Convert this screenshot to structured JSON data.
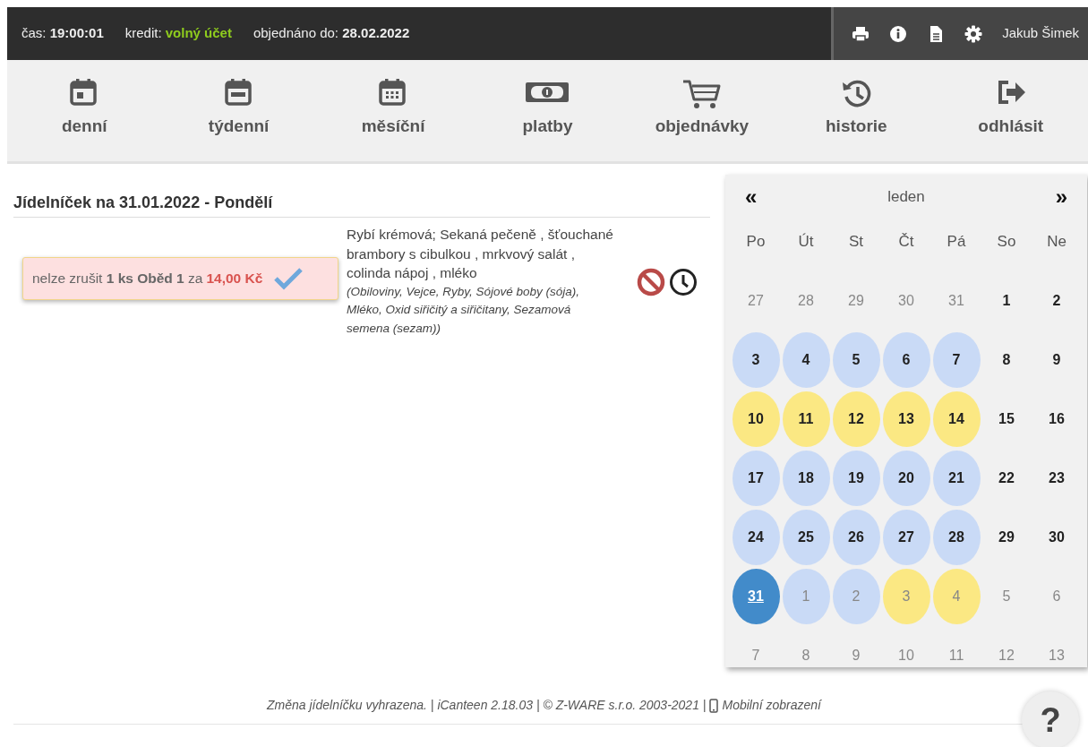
{
  "top_bar": {
    "info": [
      {
        "label": "čas:",
        "value": "19:00:01",
        "kind": "plain"
      },
      {
        "label": "kredit:",
        "value": "volný účet",
        "kind": "status"
      },
      {
        "label": "objednáno do:",
        "value": "28.02.2022",
        "kind": "plain"
      }
    ],
    "tools": [
      {
        "kind": "print"
      },
      {
        "kind": "info"
      },
      {
        "kind": "document"
      },
      {
        "kind": "settings"
      }
    ],
    "user": "Jakub Šimek"
  },
  "nav": [
    {
      "label": "denní",
      "kind": "day"
    },
    {
      "label": "týdenní",
      "kind": "week"
    },
    {
      "label": "měsíční",
      "kind": "month"
    },
    {
      "label": "platby",
      "kind": "money"
    },
    {
      "label": "objednávky",
      "kind": "cart"
    },
    {
      "label": "historie",
      "kind": "history"
    },
    {
      "label": "odhlásit",
      "kind": "logout"
    }
  ],
  "menu": {
    "title": "Jídelníček na 31.01.2022 - Pondělí",
    "order": {
      "text": "nelze zrušit **1 ks Oběd 1** za",
      "price": "14,00 Kč",
      "checked": true
    },
    "dish": "Rybí krémová; Sekaná pečeně , šťouchané brambory s cibulkou , mrkvový salát , colinda nápoj , mléko",
    "allergens": "(Obiloviny, Vejce, Ryby, Sójové boby (sója), Mléko, Oxid siřičitý a siřičitany, Sezamová semena (sezam))"
  },
  "calendar": {
    "prev": "«",
    "month": "leden",
    "next": "»",
    "weekdays": [
      "Po",
      "Út",
      "St",
      "Čt",
      "Pá",
      "So",
      "Ne"
    ],
    "days": [
      {
        "day": "27",
        "muted": true,
        "selected": false
      },
      {
        "day": "28",
        "muted": true,
        "selected": false
      },
      {
        "day": "29",
        "muted": true,
        "selected": false
      },
      {
        "day": "30",
        "muted": true,
        "selected": false
      },
      {
        "day": "31",
        "muted": true,
        "selected": false
      },
      {
        "day": "1",
        "muted": false,
        "selected": false
      },
      {
        "day": "2",
        "muted": false,
        "selected": false
      },
      {
        "day": "3",
        "muted": false,
        "selected": false,
        "color": "#c9daf6"
      },
      {
        "day": "4",
        "muted": false,
        "selected": false,
        "color": "#c9daf6"
      },
      {
        "day": "5",
        "muted": false,
        "selected": false,
        "color": "#c9daf6"
      },
      {
        "day": "6",
        "muted": false,
        "selected": false,
        "color": "#c9daf6"
      },
      {
        "day": "7",
        "muted": false,
        "selected": false,
        "color": "#c9daf6"
      },
      {
        "day": "8",
        "muted": false,
        "selected": false
      },
      {
        "day": "9",
        "muted": false,
        "selected": false
      },
      {
        "day": "10",
        "muted": false,
        "selected": false,
        "color": "#fbe883"
      },
      {
        "day": "11",
        "muted": false,
        "selected": false,
        "color": "#fbe883"
      },
      {
        "day": "12",
        "muted": false,
        "selected": false,
        "color": "#fbe883"
      },
      {
        "day": "13",
        "muted": false,
        "selected": false,
        "color": "#fbe883"
      },
      {
        "day": "14",
        "muted": false,
        "selected": false,
        "color": "#fbe883"
      },
      {
        "day": "15",
        "muted": false,
        "selected": false
      },
      {
        "day": "16",
        "muted": false,
        "selected": false
      },
      {
        "day": "17",
        "muted": false,
        "selected": false,
        "color": "#c9daf6"
      },
      {
        "day": "18",
        "muted": false,
        "selected": false,
        "color": "#c9daf6"
      },
      {
        "day": "19",
        "muted": false,
        "selected": false,
        "color": "#c9daf6"
      },
      {
        "day": "20",
        "muted": false,
        "selected": false,
        "color": "#c9daf6"
      },
      {
        "day": "21",
        "muted": false,
        "selected": false,
        "color": "#c9daf6"
      },
      {
        "day": "22",
        "muted": false,
        "selected": false
      },
      {
        "day": "23",
        "muted": false,
        "selected": false
      },
      {
        "day": "24",
        "muted": false,
        "selected": false,
        "color": "#c9daf6"
      },
      {
        "day": "25",
        "muted": false,
        "selected": false,
        "color": "#c9daf6"
      },
      {
        "day": "26",
        "muted": false,
        "selected": false,
        "color": "#c9daf6"
      },
      {
        "day": "27",
        "muted": false,
        "selected": false,
        "color": "#c9daf6"
      },
      {
        "day": "28",
        "muted": false,
        "selected": false,
        "color": "#c9daf6"
      },
      {
        "day": "29",
        "muted": false,
        "selected": false
      },
      {
        "day": "30",
        "muted": false,
        "selected": false
      },
      {
        "day": "31",
        "muted": false,
        "selected": true,
        "color": "#428bca"
      },
      {
        "day": "1",
        "muted": true,
        "selected": false,
        "color": "#c9daf6"
      },
      {
        "day": "2",
        "muted": true,
        "selected": false,
        "color": "#c9daf6"
      },
      {
        "day": "3",
        "muted": true,
        "selected": false,
        "color": "#fbe883"
      },
      {
        "day": "4",
        "muted": true,
        "selected": false,
        "color": "#fbe883"
      },
      {
        "day": "5",
        "muted": true,
        "selected": false
      },
      {
        "day": "6",
        "muted": true,
        "selected": false
      },
      {
        "day": "7",
        "muted": true,
        "selected": false
      },
      {
        "day": "8",
        "muted": true,
        "selected": false
      },
      {
        "day": "9",
        "muted": true,
        "selected": false
      },
      {
        "day": "10",
        "muted": true,
        "selected": false
      },
      {
        "day": "11",
        "muted": true,
        "selected": false
      },
      {
        "day": "12",
        "muted": true,
        "selected": false
      },
      {
        "day": "13",
        "muted": true,
        "selected": false
      }
    ]
  },
  "footer": {
    "text": "Změna jídelníčku vyhrazena. | iCanteen 2.18.03 | © Z-WARE s.r.o. 2003-2021 |",
    "mobile_link": "Mobilní zobrazení"
  },
  "help": "?"
}
